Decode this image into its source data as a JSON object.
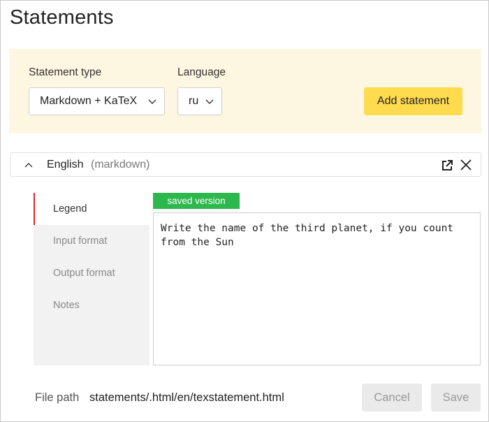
{
  "page": {
    "title": "Statements"
  },
  "toolbar": {
    "statement_type_label": "Statement type",
    "statement_type_value": "Markdown + KaTeX",
    "language_label": "Language",
    "language_value": "ru",
    "add_button": "Add statement",
    "panel_color": "#fdf7e1",
    "add_button_color": "#ffdb4d"
  },
  "statement": {
    "language": "English",
    "format": "(markdown)",
    "tabs": [
      {
        "label": "Legend",
        "active": true
      },
      {
        "label": "Input format",
        "active": false
      },
      {
        "label": "Output format",
        "active": false
      },
      {
        "label": "Notes",
        "active": false
      }
    ],
    "badge": "saved version",
    "badge_color": "#2db84d",
    "editor_text": "Write the name of the third planet, if you count\nfrom the Sun"
  },
  "footer": {
    "path_label": "File path",
    "path_value": "statements/.html/en/texstatement.html",
    "cancel": "Cancel",
    "save": "Save"
  },
  "icons": {
    "collapse": "chevron-up-icon",
    "external": "external-link-icon",
    "close": "close-icon",
    "dropdown": "chevron-down-icon"
  }
}
